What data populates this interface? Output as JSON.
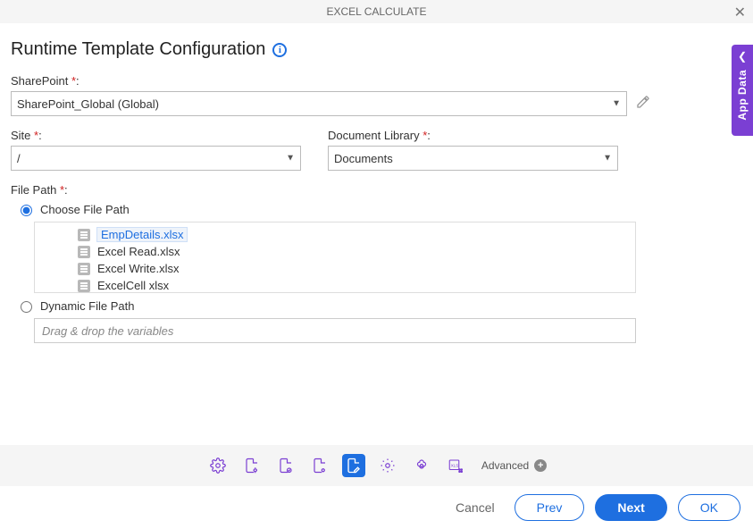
{
  "title": "EXCEL CALCULATE",
  "page_heading": "Runtime Template Configuration",
  "sidetab_label": "App Data",
  "labels": {
    "sharepoint": "SharePoint",
    "site": "Site",
    "doclib": "Document Library",
    "filepath": "File Path",
    "choose_path": "Choose File Path",
    "dynamic_path": "Dynamic File Path"
  },
  "values": {
    "sharepoint": "SharePoint_Global (Global)",
    "site": "/",
    "doclib": "Documents",
    "drop_placeholder": "Drag & drop the variables"
  },
  "files": [
    "EmpDetails.xlsx",
    "Excel Read.xlsx",
    "Excel Write.xlsx",
    "ExcelCell xlsx"
  ],
  "toolbar": {
    "advanced": "Advanced"
  },
  "buttons": {
    "cancel": "Cancel",
    "prev": "Prev",
    "next": "Next",
    "ok": "OK"
  }
}
